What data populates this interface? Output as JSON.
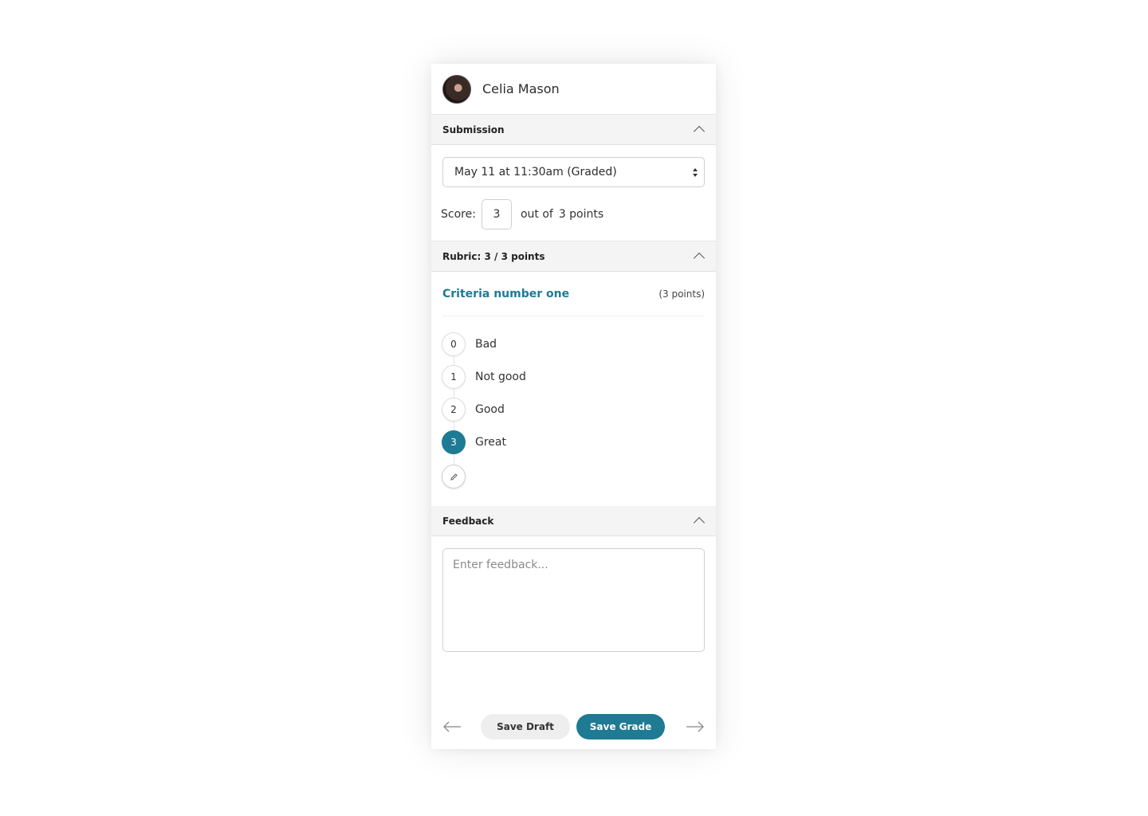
{
  "student": {
    "name": "Celia Mason"
  },
  "submission": {
    "title": "Submission",
    "selected_attempt": "May 11 at 11:30am (Graded)",
    "score_label": "Score:",
    "score_value": "3",
    "out_of_label": "out of",
    "points_text": "3 points"
  },
  "rubric": {
    "title": "Rubric: 3 / 3 points",
    "criteria": {
      "name": "Criteria number one",
      "points": "(3 points)"
    },
    "ratings": [
      {
        "value": "0",
        "label": "Bad",
        "selected": false
      },
      {
        "value": "1",
        "label": "Not good",
        "selected": false
      },
      {
        "value": "2",
        "label": "Good",
        "selected": false
      },
      {
        "value": "3",
        "label": "Great",
        "selected": true
      }
    ]
  },
  "feedback": {
    "title": "Feedback",
    "placeholder": "Enter feedback..."
  },
  "footer": {
    "save_draft_label": "Save Draft",
    "save_grade_label": "Save Grade"
  },
  "colors": {
    "accent": "#1f7a93",
    "section_bg": "#f4f4f4"
  },
  "icons": {
    "collapse": "chevron-up-icon",
    "select": "sort-arrows-icon",
    "edit": "pencil-icon",
    "prev": "arrow-left-icon",
    "next": "arrow-right-icon"
  }
}
